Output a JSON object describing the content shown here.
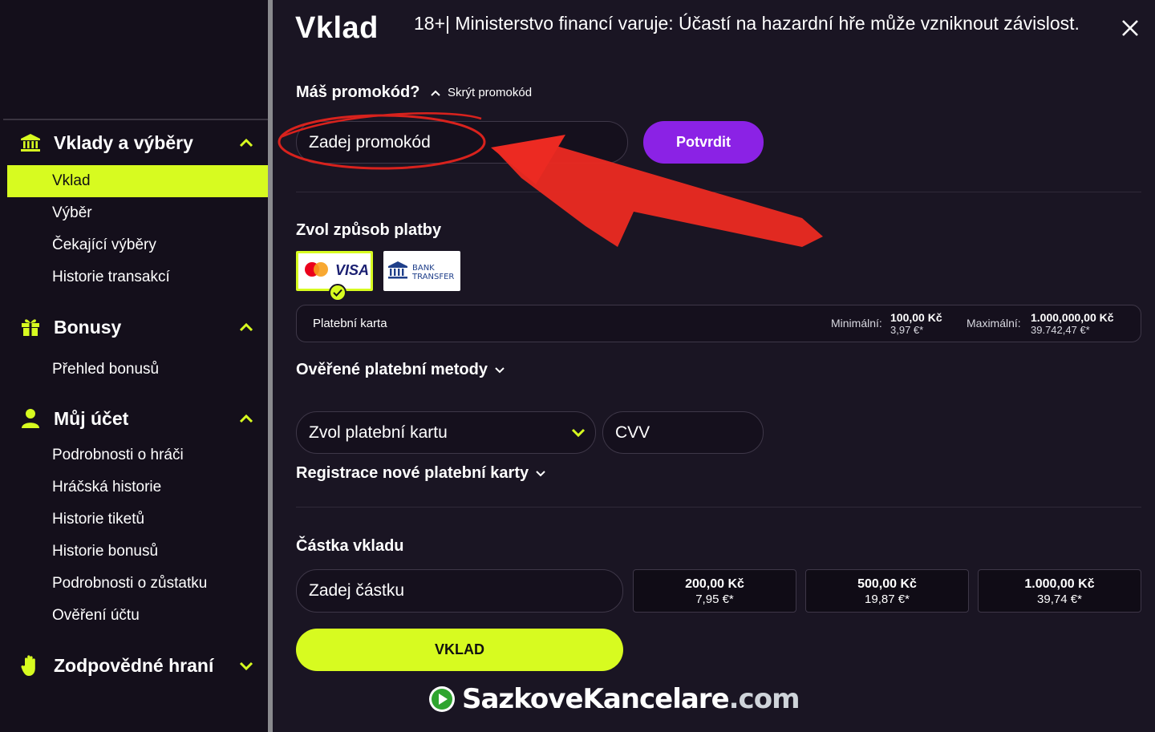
{
  "sidebar": {
    "sections": [
      {
        "label": "Vklady a výběry",
        "icon": "bank-icon",
        "expanded": true,
        "items": [
          {
            "label": "Vklad",
            "active": true
          },
          {
            "label": "Výběr"
          },
          {
            "label": "Čekající výběry"
          },
          {
            "label": "Historie transakcí"
          }
        ]
      },
      {
        "label": "Bonusy",
        "icon": "gift-icon",
        "expanded": true,
        "items": [
          {
            "label": "Přehled bonusů"
          }
        ]
      },
      {
        "label": "Můj účet",
        "icon": "user-icon",
        "expanded": true,
        "items": [
          {
            "label": "Podrobnosti o hráči"
          },
          {
            "label": "Hráčská historie"
          },
          {
            "label": "Historie tiketů"
          },
          {
            "label": "Historie bonusů"
          },
          {
            "label": "Podrobnosti o zůstatku"
          },
          {
            "label": "Ověření účtu"
          }
        ]
      },
      {
        "label": "Zodpovědné hraní",
        "icon": "hand-icon",
        "expanded": false,
        "items": []
      }
    ]
  },
  "header": {
    "title": "Vklad",
    "warning": "18+| Ministerstvo financí varuje: Účastí na hazardní hře může vzniknout závislost."
  },
  "promo": {
    "question": "Máš promokód?",
    "hide_link": "Skrýt promokód",
    "placeholder": "Zadej promokód",
    "confirm": "Potvrdit"
  },
  "payment": {
    "heading": "Zvol způsob platby",
    "methods": [
      {
        "name": "card",
        "labels": [
          "VISA"
        ],
        "selected": true
      },
      {
        "name": "bank-transfer",
        "labels": [
          "BANK",
          "TRANSFER"
        ],
        "selected": false
      }
    ],
    "info": {
      "title": "Platební karta",
      "min_label": "Minimální:",
      "min_value": "100,00 Kč",
      "min_eur": "3,97 €*",
      "max_label": "Maximální:",
      "max_value": "1.000,000,00 Kč",
      "max_eur": "39.742,47 €*"
    },
    "verified_methods": "Ověřené platební metody",
    "card_select": "Zvol platební kartu",
    "cvv": "CVV",
    "register_card": "Registrace nové platební karty"
  },
  "amount": {
    "heading": "Částka vkladu",
    "placeholder": "Zadej částku",
    "presets": [
      {
        "czk": "200,00 Kč",
        "eur": "7,95 €*"
      },
      {
        "czk": "500,00 Kč",
        "eur": "19,87 €*"
      },
      {
        "czk": "1.000,00 Kč",
        "eur": "39,74 €*"
      }
    ],
    "submit": "VKLAD"
  },
  "watermark": {
    "name": "SazkoveKancelare",
    "tld": ".com"
  },
  "colors": {
    "accent": "#d7fb20",
    "purple": "#8b22e5",
    "annotation": "#e3241f",
    "background": "#1a1523"
  }
}
